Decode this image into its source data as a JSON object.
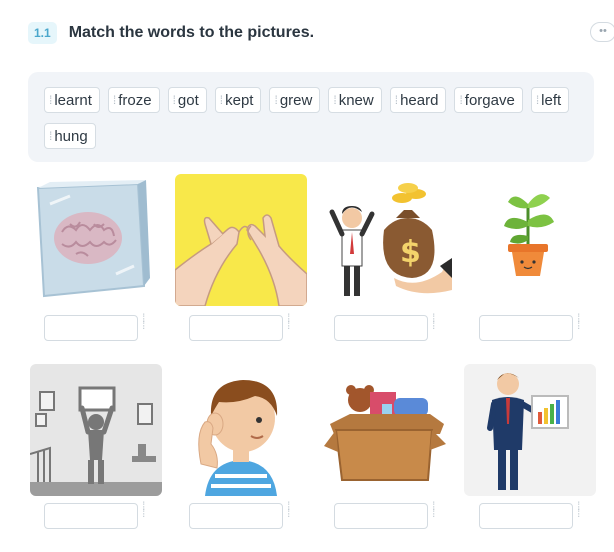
{
  "task": {
    "number": "1.1",
    "title": "Match the words to the pictures."
  },
  "more_icon": "••",
  "word_bank": [
    "learnt",
    "froze",
    "got",
    "kept",
    "grew",
    "knew",
    "heard",
    "forgave",
    "left",
    "hung"
  ],
  "pictures": [
    {
      "icon": "frozen-brain-icon"
    },
    {
      "icon": "pinky-promise-icon"
    },
    {
      "icon": "man-money-bag-icon"
    },
    {
      "icon": "potted-plant-icon"
    },
    {
      "icon": "man-hanging-picture-icon"
    },
    {
      "icon": "boy-listening-icon"
    },
    {
      "icon": "box-of-toys-icon"
    },
    {
      "icon": "man-presenting-chart-icon"
    }
  ],
  "colors": {
    "accent": "#4aa7cc",
    "word_bank_bg": "#f1f4f8",
    "yellow_bg": "#f8e84a"
  }
}
